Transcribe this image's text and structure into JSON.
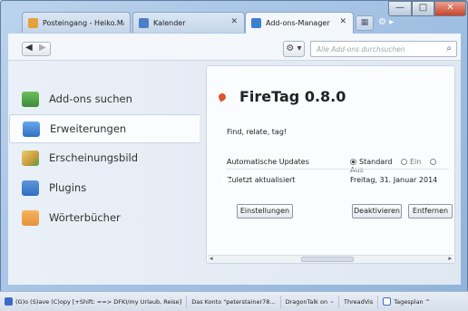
{
  "window": {
    "controls": {
      "minimize": "—",
      "maximize": "□",
      "close": "✕"
    }
  },
  "tabs": [
    {
      "label": "Posteingang - Heiko.Maus...",
      "icon": "mail-icon",
      "active": false
    },
    {
      "label": "Kalender",
      "icon": "calendar-icon",
      "active": false
    },
    {
      "label": "Add-ons-Manager",
      "icon": "puzzle-icon",
      "active": true
    }
  ],
  "toolbar": {
    "back": "◀",
    "forward": "▶",
    "gear": "⚙ ▾",
    "search_placeholder": "Alle Add-ons durchsuchen",
    "search_icon": "⌕"
  },
  "sidebar": {
    "items": [
      {
        "label": "Add-ons suchen",
        "icon": "download-icon",
        "color": "#3d8a3d",
        "selected": false
      },
      {
        "label": "Erweiterungen",
        "icon": "puzzle-icon",
        "color": "#3b7fd1",
        "selected": true
      },
      {
        "label": "Erscheinungsbild",
        "icon": "paintbrush-icon",
        "color": "#c89a3a",
        "selected": false
      },
      {
        "label": "Plugins",
        "icon": "plugin-icon",
        "color": "#2f6fc4",
        "selected": false
      },
      {
        "label": "Wörterbücher",
        "icon": "dictionary-icon",
        "color": "#e6923a",
        "selected": false
      }
    ]
  },
  "detail": {
    "name": "FireTag 0.8.0",
    "description": "Find, relate, tag!",
    "updates_label": "Automatische Updates",
    "update_options": [
      "Standard",
      "Ein",
      "Aus"
    ],
    "update_selected": "Standard",
    "updated_label": "Zuletzt aktualisiert",
    "updated_value": "Freitag, 31. Januar 2014",
    "settings_button": "Einstellungen",
    "disable_button": "Deaktivieren",
    "remove_button": "Entfernen"
  },
  "statusbar": {
    "items": [
      "(G)o (S)ave (C)opy [+Shift: ==> DFKI/my Urlaub, Reise]",
      "Das Konto \"peterstainer78...",
      "DragonTalk on",
      "ThreadVis",
      "Tagesplan ^"
    ]
  },
  "colors": {
    "accent": "#3b7fd1",
    "close_red": "#c8442c",
    "ext_icon": "#d9572b"
  }
}
